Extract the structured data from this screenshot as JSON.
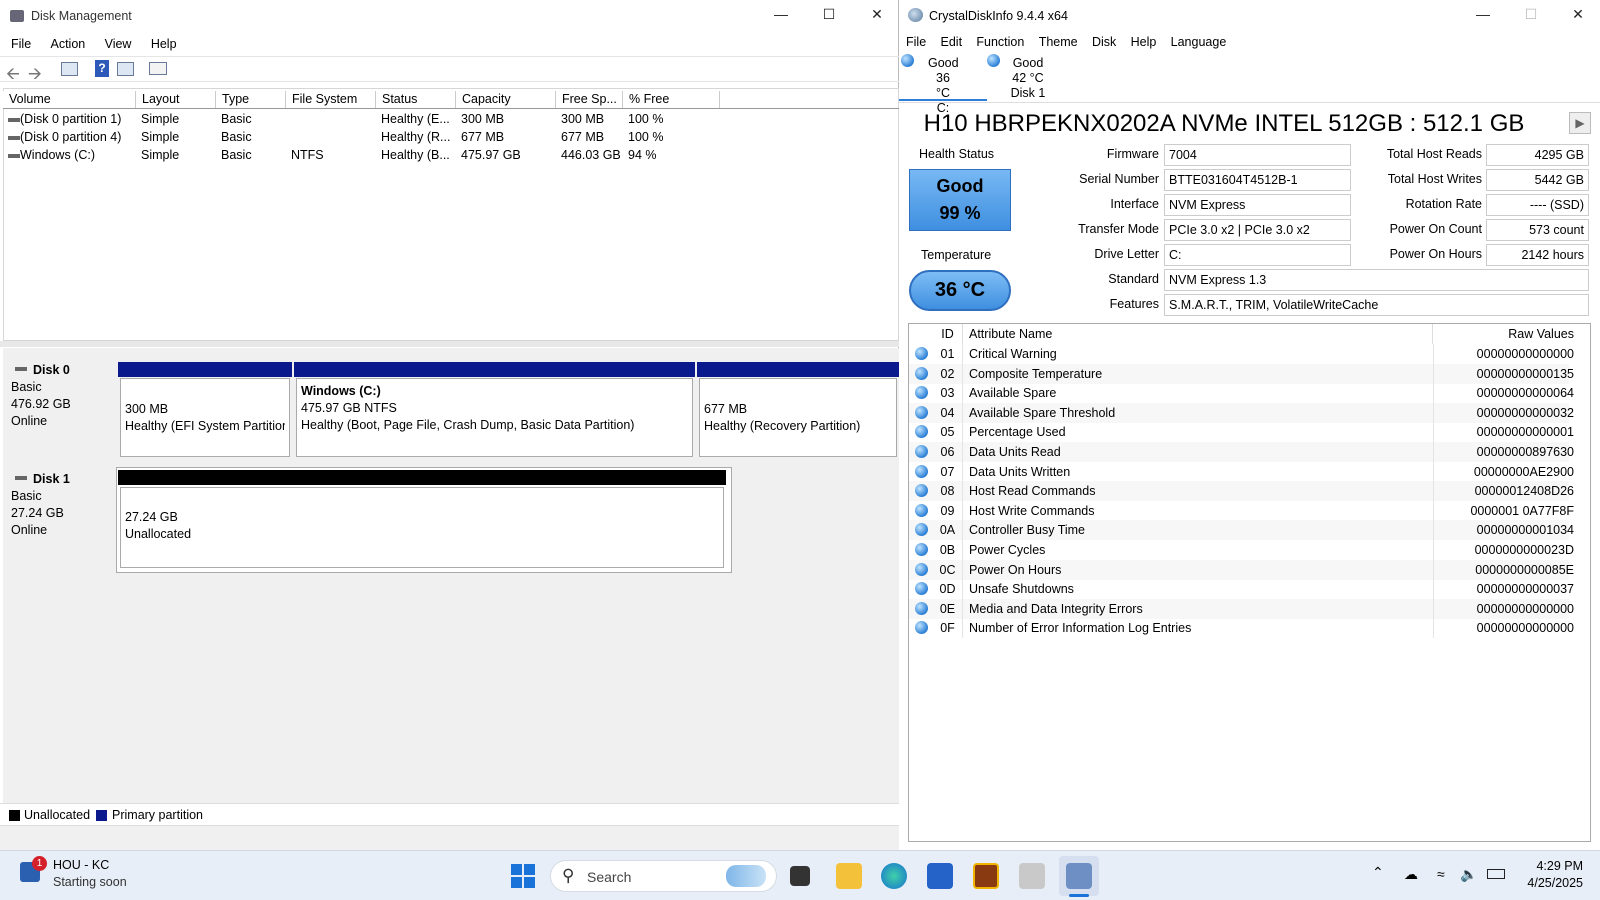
{
  "dm": {
    "title": "Disk Management",
    "menu": [
      "File",
      "Action",
      "View",
      "Help"
    ],
    "columns": [
      "Volume",
      "Layout",
      "Type",
      "File System",
      "Status",
      "Capacity",
      "Free Sp...",
      "% Free"
    ],
    "rows": [
      [
        "(Disk 0 partition 1)",
        "Simple",
        "Basic",
        "",
        "Healthy (E...",
        "300 MB",
        "300 MB",
        "100 %"
      ],
      [
        "(Disk 0 partition 4)",
        "Simple",
        "Basic",
        "",
        "Healthy (R...",
        "677 MB",
        "677 MB",
        "100 %"
      ],
      [
        "Windows (C:)",
        "Simple",
        "Basic",
        "NTFS",
        "Healthy (B...",
        "475.97 GB",
        "446.03 GB",
        "94 %"
      ]
    ],
    "disk0": {
      "name": "Disk 0",
      "type": "Basic",
      "size": "476.92 GB",
      "state": "Online",
      "p1": {
        "size": "300 MB",
        "status": "Healthy (EFI System Partition"
      },
      "p2": {
        "name": "Windows  (C:)",
        "size": "475.97 GB NTFS",
        "status": "Healthy (Boot, Page File, Crash Dump, Basic Data Partition)"
      },
      "p3": {
        "size": "677 MB",
        "status": "Healthy (Recovery Partition)"
      }
    },
    "disk1": {
      "name": "Disk 1",
      "type": "Basic",
      "size": "27.24 GB",
      "state": "Online",
      "p1": {
        "size": "27.24 GB",
        "status": "Unallocated"
      }
    },
    "legend": {
      "unallocated": "Unallocated",
      "primary": "Primary partition"
    },
    "colors": {
      "primary": "#0a1a8c",
      "unallocated": "#000000"
    }
  },
  "cdi": {
    "title": "CrystalDiskInfo 9.4.4 x64",
    "menu": [
      "File",
      "Edit",
      "Function",
      "Theme",
      "Disk",
      "Help",
      "Language"
    ],
    "drives": [
      {
        "status": "Good",
        "temp": "36 °C",
        "label": "C:"
      },
      {
        "status": "Good",
        "temp": "42 °C",
        "label": "Disk 1"
      }
    ],
    "model": "H10 HBRPEKNX0202A NVMe INTEL 512GB : 512.1 GB",
    "health_label": "Health Status",
    "health_status": "Good",
    "health_pct": "99 %",
    "temp_label": "Temperature",
    "temp": "36 °C",
    "fields": {
      "firmware_l": "Firmware",
      "firmware": "7004",
      "serial_l": "Serial Number",
      "serial": "BTTE031604T4512B-1",
      "interface_l": "Interface",
      "interface": "NVM Express",
      "transfer_l": "Transfer Mode",
      "transfer": "PCIe 3.0 x2 | PCIe 3.0 x2",
      "drive_l": "Drive Letter",
      "drive": "C:",
      "standard_l": "Standard",
      "standard": "NVM Express 1.3",
      "features_l": "Features",
      "features": "S.M.A.R.T., TRIM, VolatileWriteCache",
      "reads_l": "Total Host Reads",
      "reads": "4295 GB",
      "writes_l": "Total Host Writes",
      "writes": "5442 GB",
      "rotation_l": "Rotation Rate",
      "rotation": "---- (SSD)",
      "poc_l": "Power On Count",
      "poc": "573 count",
      "poh_l": "Power On Hours",
      "poh": "2142 hours"
    },
    "smart_headers": [
      "ID",
      "Attribute Name",
      "Raw Values"
    ],
    "smart": [
      [
        "01",
        "Critical Warning",
        "00000000000000"
      ],
      [
        "02",
        "Composite Temperature",
        "00000000000135"
      ],
      [
        "03",
        "Available Spare",
        "00000000000064"
      ],
      [
        "04",
        "Available Spare Threshold",
        "00000000000032"
      ],
      [
        "05",
        "Percentage Used",
        "00000000000001"
      ],
      [
        "06",
        "Data Units Read",
        "00000000897630"
      ],
      [
        "07",
        "Data Units Written",
        "00000000AE2900"
      ],
      [
        "08",
        "Host Read Commands",
        "00000012408D26"
      ],
      [
        "09",
        "Host Write Commands",
        "0000001 0A77F8F"
      ],
      [
        "0A",
        "Controller Busy Time",
        "00000000001034"
      ],
      [
        "0B",
        "Power Cycles",
        "0000000000023D"
      ],
      [
        "0C",
        "Power On Hours",
        "0000000000085E"
      ],
      [
        "0D",
        "Unsafe Shutdowns",
        "00000000000037"
      ],
      [
        "0E",
        "Media and Data Integrity Errors",
        "00000000000000"
      ],
      [
        "0F",
        "Number of Error Information Log Entries",
        "00000000000000"
      ]
    ],
    "health_color": "#3a86e0"
  },
  "taskbar": {
    "weather_badge": "1",
    "weather_title": "HOU - KC",
    "weather_sub": "Starting soon",
    "search": "Search",
    "time": "4:29 PM",
    "date": "4/25/2025"
  }
}
